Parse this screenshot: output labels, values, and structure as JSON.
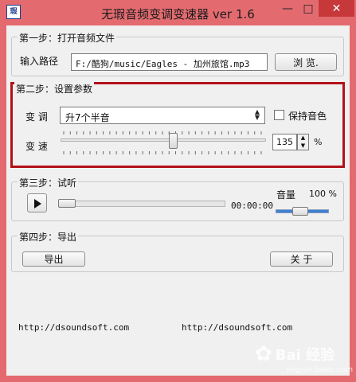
{
  "window": {
    "title": "无瑕音频变调变速器 ver 1.6",
    "icon_text": "瑕",
    "minimize_glyph": "—",
    "maximize_glyph": "□",
    "close_glyph": "✕"
  },
  "step1": {
    "label": "第一步：打开音频文件",
    "path_label": "输入路径",
    "path_value": "F:/酷狗/music/Eagles - 加州旅馆.mp3",
    "browse_label": "浏 览."
  },
  "step2": {
    "label": "第二步：设置参数",
    "pitch_label": "变 调",
    "pitch_value": "升7个半音",
    "keep_tone_label": "保持音色",
    "keep_tone_checked": false,
    "speed_label": "变 速",
    "speed_slider_percent": 55,
    "speed_value": "135",
    "speed_unit": "%",
    "spin_up": "▲",
    "spin_down": "▼"
  },
  "step3": {
    "label": "第三步：试听",
    "time": "00:00:00",
    "volume_label": "音量",
    "volume_value": "100 %",
    "progress_percent": 0
  },
  "step4": {
    "label": "第四步：导出",
    "export_label": "导出",
    "about_label": "关 于"
  },
  "links": {
    "left": "http://dsoundsoft.com",
    "right": "http://dsoundsoft.com"
  },
  "watermark": {
    "text": "Bai 经验",
    "sub": "jingyan.baidu.com"
  },
  "icons": [
    "app-icon",
    "minimize-icon",
    "maximize-icon",
    "close-icon",
    "dropdown-arrow-icon",
    "play-icon",
    "spin-up-icon",
    "spin-down-icon"
  ],
  "colors": {
    "frame": "#e36b70",
    "highlight_border": "#b3111a",
    "close_button": "#c7383b",
    "volume_fill": "#3b7fd6"
  }
}
